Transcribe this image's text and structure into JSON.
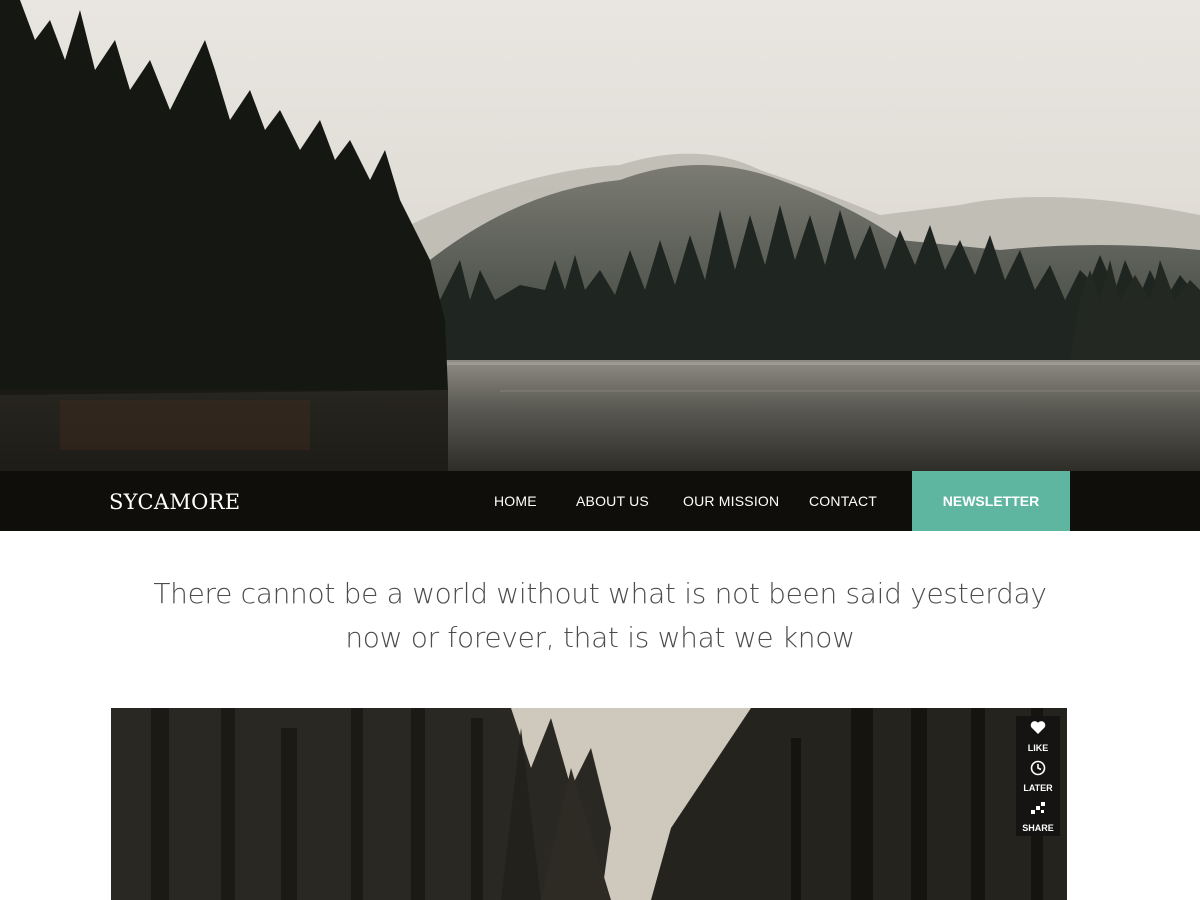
{
  "brand": "SYCAMORE",
  "nav": {
    "home": "HOME",
    "about": "ABOUT US",
    "mission": "OUR MISSION",
    "contact": "CONTACT",
    "newsletter": "NEWSLETTER"
  },
  "tagline": {
    "line1": "There cannot be a world without what is not been said yesterday",
    "line2": "now or forever, that is what we know"
  },
  "social": {
    "like": "LIKE",
    "later": "LATER",
    "share": "SHARE"
  },
  "colors": {
    "nav_bg": "#0f0e0a",
    "accent": "#5fb6a0",
    "text": "#4c4c4c"
  },
  "icons": [
    "heart-icon",
    "clock-icon",
    "share-icon"
  ]
}
